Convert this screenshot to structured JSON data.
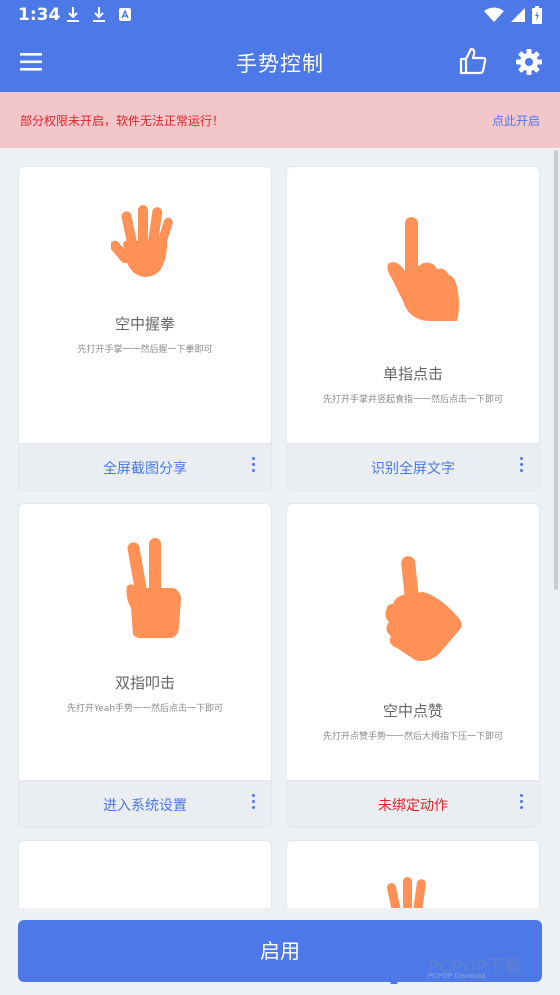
{
  "status_bar": {
    "time": "1:34",
    "icons_left": [
      "download-icon",
      "download-icon",
      "font-icon"
    ],
    "icons_right": [
      "wifi-icon",
      "signal-icon",
      "battery-icon"
    ]
  },
  "app_bar": {
    "title": "手势控制",
    "background": "#4c78e8"
  },
  "warning": {
    "text": "部分权限未开启，软件无法正常运行！",
    "link": "点此开启"
  },
  "cards": [
    {
      "gesture": "空中握拳",
      "hint": "先打开手掌一一然后握一下拳即可",
      "action": "全屏截图分享"
    },
    {
      "gesture": "单指点击",
      "hint": "先打开手掌并竖起食指一一然后点击一下即可",
      "action": "识别全屏文字"
    },
    {
      "gesture": "双指叩击",
      "hint": "先打开Yeah手势一一然后点击一下即可",
      "action": "进入系统设置"
    },
    {
      "gesture": "空中点赞",
      "hint": "先打开点赞手势一一然后大拇指下压一下即可",
      "action": "未绑定动作"
    }
  ],
  "accent_color": "#4c78e8",
  "hand_color": "#ff9157",
  "unbound_color": "#e0232b",
  "enable_button": "启用",
  "watermark": {
    "brand": "PCPOP下载",
    "sub": "PCPOP Download"
  }
}
